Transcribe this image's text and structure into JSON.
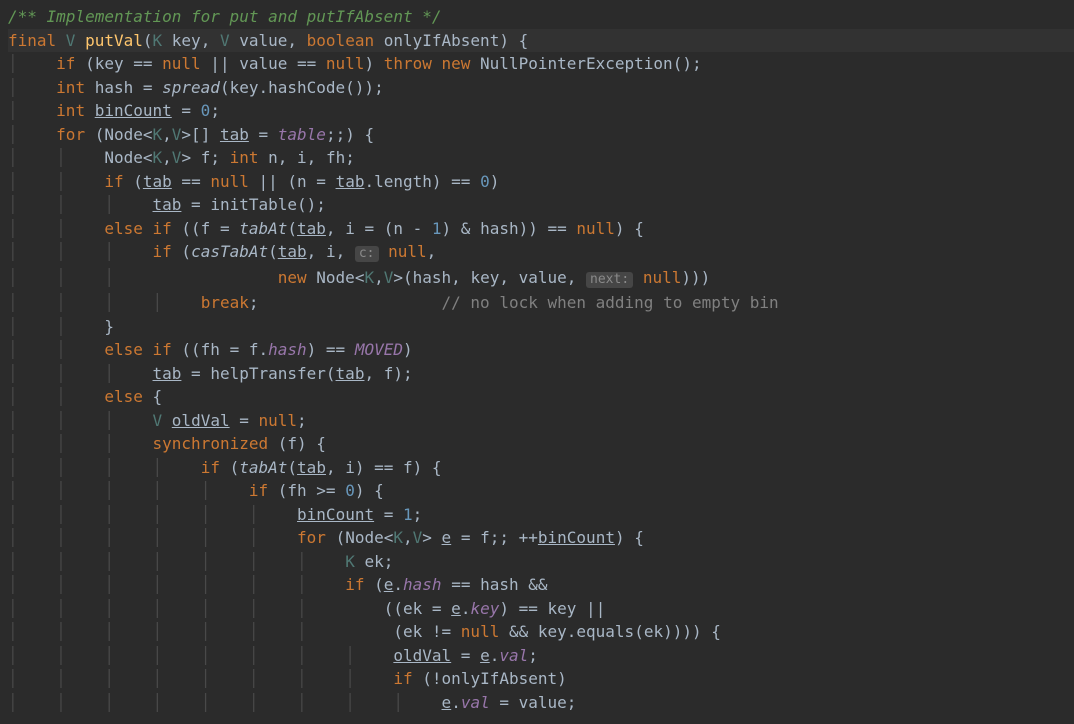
{
  "lines": [
    {
      "class": "doc-comment",
      "text": "/** Implementation for put and putIfAbsent */"
    },
    {
      "class": "current-line",
      "tokens": [
        {
          "c": "keyword",
          "t": "final "
        },
        {
          "c": "type-param",
          "t": "V"
        },
        {
          "c": "",
          "t": " "
        },
        {
          "c": "method-decl",
          "t": "putVal"
        },
        {
          "c": "",
          "t": "("
        },
        {
          "c": "type-param",
          "t": "K"
        },
        {
          "c": "",
          "t": " key, "
        },
        {
          "c": "type-param",
          "t": "V"
        },
        {
          "c": "",
          "t": " value, "
        },
        {
          "c": "keyword",
          "t": "boolean"
        },
        {
          "c": "",
          "t": " onlyIfAbsent) {"
        }
      ]
    },
    {
      "indent": 1,
      "tokens": [
        {
          "c": "keyword",
          "t": "if "
        },
        {
          "c": "",
          "t": "(key == "
        },
        {
          "c": "keyword",
          "t": "null"
        },
        {
          "c": "",
          "t": " || value == "
        },
        {
          "c": "keyword",
          "t": "null"
        },
        {
          "c": "",
          "t": ") "
        },
        {
          "c": "keyword",
          "t": "throw new "
        },
        {
          "c": "",
          "t": "NullPointerException();"
        }
      ]
    },
    {
      "indent": 1,
      "tokens": [
        {
          "c": "keyword",
          "t": "int "
        },
        {
          "c": "",
          "t": "hash = "
        },
        {
          "c": "func-italic",
          "t": "spread"
        },
        {
          "c": "",
          "t": "(key.hashCode());"
        }
      ]
    },
    {
      "indent": 1,
      "tokens": [
        {
          "c": "keyword",
          "t": "int "
        },
        {
          "c": "underline",
          "t": "binCount"
        },
        {
          "c": "",
          "t": " = "
        },
        {
          "c": "number",
          "t": "0"
        },
        {
          "c": "",
          "t": ";"
        }
      ]
    },
    {
      "indent": 1,
      "tokens": [
        {
          "c": "keyword",
          "t": "for "
        },
        {
          "c": "",
          "t": "(Node<"
        },
        {
          "c": "type-param",
          "t": "K"
        },
        {
          "c": "",
          "t": ","
        },
        {
          "c": "type-param",
          "t": "V"
        },
        {
          "c": "",
          "t": ">[] "
        },
        {
          "c": "underline",
          "t": "tab"
        },
        {
          "c": "",
          "t": " = "
        },
        {
          "c": "field-ref",
          "t": "table"
        },
        {
          "c": "",
          "t": ";;) {"
        }
      ]
    },
    {
      "indent": 2,
      "tokens": [
        {
          "c": "",
          "t": "Node<"
        },
        {
          "c": "type-param",
          "t": "K"
        },
        {
          "c": "",
          "t": ","
        },
        {
          "c": "type-param",
          "t": "V"
        },
        {
          "c": "",
          "t": "> f; "
        },
        {
          "c": "keyword",
          "t": "int "
        },
        {
          "c": "",
          "t": "n, i, fh;"
        }
      ]
    },
    {
      "indent": 2,
      "tokens": [
        {
          "c": "keyword",
          "t": "if "
        },
        {
          "c": "",
          "t": "("
        },
        {
          "c": "underline",
          "t": "tab"
        },
        {
          "c": "",
          "t": " == "
        },
        {
          "c": "keyword",
          "t": "null"
        },
        {
          "c": "",
          "t": " || (n = "
        },
        {
          "c": "underline",
          "t": "tab"
        },
        {
          "c": "",
          "t": ".length) == "
        },
        {
          "c": "number",
          "t": "0"
        },
        {
          "c": "",
          "t": ")"
        }
      ]
    },
    {
      "indent": 3,
      "tokens": [
        {
          "c": "underline",
          "t": "tab"
        },
        {
          "c": "",
          "t": " = initTable();"
        }
      ]
    },
    {
      "indent": 2,
      "tokens": [
        {
          "c": "keyword",
          "t": "else if "
        },
        {
          "c": "",
          "t": "((f = "
        },
        {
          "c": "func-italic",
          "t": "tabAt"
        },
        {
          "c": "",
          "t": "("
        },
        {
          "c": "underline",
          "t": "tab"
        },
        {
          "c": "",
          "t": ", i = (n - "
        },
        {
          "c": "number",
          "t": "1"
        },
        {
          "c": "",
          "t": ") & hash)) == "
        },
        {
          "c": "keyword",
          "t": "null"
        },
        {
          "c": "",
          "t": ") {"
        }
      ]
    },
    {
      "indent": 3,
      "tokens": [
        {
          "c": "keyword",
          "t": "if "
        },
        {
          "c": "",
          "t": "("
        },
        {
          "c": "func-italic",
          "t": "casTabAt"
        },
        {
          "c": "",
          "t": "("
        },
        {
          "c": "underline",
          "t": "tab"
        },
        {
          "c": "",
          "t": ", i, "
        },
        {
          "c": "param-hint",
          "t": "c:"
        },
        {
          "c": "",
          "t": " "
        },
        {
          "c": "keyword",
          "t": "null"
        },
        {
          "c": "",
          "t": ","
        }
      ]
    },
    {
      "indent": 3,
      "pre": "             ",
      "tokens": [
        {
          "c": "keyword",
          "t": "new "
        },
        {
          "c": "",
          "t": "Node<"
        },
        {
          "c": "type-param",
          "t": "K"
        },
        {
          "c": "",
          "t": ","
        },
        {
          "c": "type-param",
          "t": "V"
        },
        {
          "c": "",
          "t": ">(hash, key, value, "
        },
        {
          "c": "param-hint",
          "t": "next:"
        },
        {
          "c": "",
          "t": " "
        },
        {
          "c": "keyword",
          "t": "null"
        },
        {
          "c": "",
          "t": ")))"
        }
      ]
    },
    {
      "indent": 4,
      "tokens": [
        {
          "c": "keyword",
          "t": "break"
        },
        {
          "c": "",
          "t": ";                   "
        },
        {
          "c": "comment",
          "t": "// no lock when adding to empty bin"
        }
      ]
    },
    {
      "indent": 2,
      "tokens": [
        {
          "c": "",
          "t": "}"
        }
      ]
    },
    {
      "indent": 2,
      "tokens": [
        {
          "c": "keyword",
          "t": "else if "
        },
        {
          "c": "",
          "t": "((fh = f."
        },
        {
          "c": "field-ref",
          "t": "hash"
        },
        {
          "c": "",
          "t": ") == "
        },
        {
          "c": "static-field",
          "t": "MOVED"
        },
        {
          "c": "",
          "t": ")"
        }
      ]
    },
    {
      "indent": 3,
      "tokens": [
        {
          "c": "underline",
          "t": "tab"
        },
        {
          "c": "",
          "t": " = helpTransfer("
        },
        {
          "c": "underline",
          "t": "tab"
        },
        {
          "c": "",
          "t": ", f);"
        }
      ]
    },
    {
      "indent": 2,
      "tokens": [
        {
          "c": "keyword",
          "t": "else "
        },
        {
          "c": "",
          "t": "{"
        }
      ]
    },
    {
      "indent": 3,
      "tokens": [
        {
          "c": "type-param",
          "t": "V"
        },
        {
          "c": "",
          "t": " "
        },
        {
          "c": "underline",
          "t": "oldVal"
        },
        {
          "c": "",
          "t": " = "
        },
        {
          "c": "keyword",
          "t": "null"
        },
        {
          "c": "",
          "t": ";"
        }
      ]
    },
    {
      "indent": 3,
      "tokens": [
        {
          "c": "keyword",
          "t": "synchronized "
        },
        {
          "c": "",
          "t": "(f) {"
        }
      ]
    },
    {
      "indent": 4,
      "tokens": [
        {
          "c": "keyword",
          "t": "if "
        },
        {
          "c": "",
          "t": "("
        },
        {
          "c": "func-italic",
          "t": "tabAt"
        },
        {
          "c": "",
          "t": "("
        },
        {
          "c": "underline",
          "t": "tab"
        },
        {
          "c": "",
          "t": ", i) == f) {"
        }
      ]
    },
    {
      "indent": 5,
      "tokens": [
        {
          "c": "keyword",
          "t": "if "
        },
        {
          "c": "",
          "t": "(fh >= "
        },
        {
          "c": "number",
          "t": "0"
        },
        {
          "c": "",
          "t": ") {"
        }
      ]
    },
    {
      "indent": 6,
      "tokens": [
        {
          "c": "underline",
          "t": "binCount"
        },
        {
          "c": "",
          "t": " = "
        },
        {
          "c": "number",
          "t": "1"
        },
        {
          "c": "",
          "t": ";"
        }
      ]
    },
    {
      "indent": 6,
      "tokens": [
        {
          "c": "keyword",
          "t": "for "
        },
        {
          "c": "",
          "t": "(Node<"
        },
        {
          "c": "type-param",
          "t": "K"
        },
        {
          "c": "",
          "t": ","
        },
        {
          "c": "type-param",
          "t": "V"
        },
        {
          "c": "",
          "t": "> "
        },
        {
          "c": "underline",
          "t": "e"
        },
        {
          "c": "",
          "t": " = f;; ++"
        },
        {
          "c": "underline",
          "t": "binCount"
        },
        {
          "c": "",
          "t": ") {"
        }
      ]
    },
    {
      "indent": 7,
      "tokens": [
        {
          "c": "type-param",
          "t": "K"
        },
        {
          "c": "",
          "t": " ek;"
        }
      ]
    },
    {
      "indent": 7,
      "tokens": [
        {
          "c": "keyword",
          "t": "if "
        },
        {
          "c": "",
          "t": "("
        },
        {
          "c": "underline",
          "t": "e"
        },
        {
          "c": "",
          "t": "."
        },
        {
          "c": "field-ref",
          "t": "hash"
        },
        {
          "c": "",
          "t": " == hash &&"
        }
      ]
    },
    {
      "indent": 7,
      "pre": "    ",
      "tokens": [
        {
          "c": "",
          "t": "((ek = "
        },
        {
          "c": "underline",
          "t": "e"
        },
        {
          "c": "",
          "t": "."
        },
        {
          "c": "field-ref",
          "t": "key"
        },
        {
          "c": "",
          "t": ") == key ||"
        }
      ]
    },
    {
      "indent": 7,
      "pre": "     ",
      "tokens": [
        {
          "c": "",
          "t": "(ek != "
        },
        {
          "c": "keyword",
          "t": "null"
        },
        {
          "c": "",
          "t": " && key.equals(ek)))) {"
        }
      ]
    },
    {
      "indent": 8,
      "tokens": [
        {
          "c": "underline",
          "t": "oldVal"
        },
        {
          "c": "",
          "t": " = "
        },
        {
          "c": "underline",
          "t": "e"
        },
        {
          "c": "",
          "t": "."
        },
        {
          "c": "field-ref",
          "t": "val"
        },
        {
          "c": "",
          "t": ";"
        }
      ]
    },
    {
      "indent": 8,
      "tokens": [
        {
          "c": "keyword",
          "t": "if "
        },
        {
          "c": "",
          "t": "(!onlyIfAbsent)"
        }
      ]
    },
    {
      "indent": 9,
      "tokens": [
        {
          "c": "underline",
          "t": "e"
        },
        {
          "c": "",
          "t": "."
        },
        {
          "c": "field-ref",
          "t": "val"
        },
        {
          "c": "",
          "t": " = value;"
        }
      ]
    }
  ]
}
